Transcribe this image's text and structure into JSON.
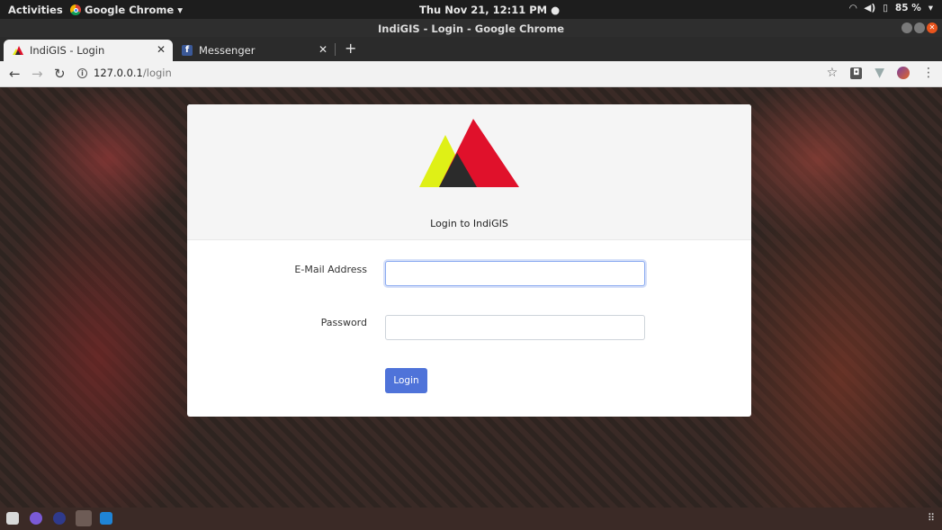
{
  "system_bar": {
    "activities": "Activities",
    "app_name": "Google Chrome",
    "clock": "Thu Nov 21, 12:11 PM",
    "battery": "85 %"
  },
  "window": {
    "title": "IndiGIS - Login - Google Chrome"
  },
  "tabs": [
    {
      "label": "IndiGIS - Login",
      "active": true
    },
    {
      "label": "Messenger",
      "active": false
    }
  ],
  "address_bar": {
    "host": "127.0.0.1",
    "path": "/login"
  },
  "login": {
    "title": "Login to IndiGIS",
    "email_label": "E-Mail Address",
    "email_value": "",
    "password_label": "Password",
    "password_value": "",
    "button_label": "Login"
  },
  "colors": {
    "accent_button": "#4f73d9",
    "logo_red": "#e0112b",
    "logo_yellow": "#dff016",
    "logo_dark": "#2b2b2b"
  }
}
